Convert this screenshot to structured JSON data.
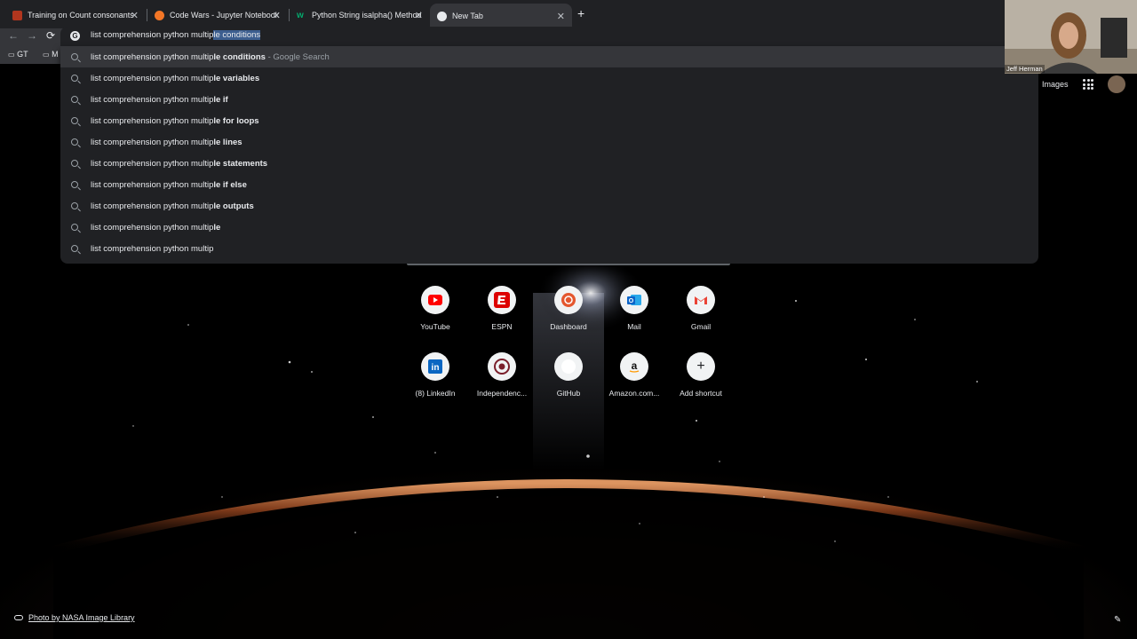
{
  "tabs": [
    {
      "title": "Training on Count consonants",
      "icon": "codewars-icon",
      "color": "#b1361e"
    },
    {
      "title": "Code Wars - Jupyter Notebook",
      "icon": "jupyter-icon",
      "color": "#f37626"
    },
    {
      "title": "Python String isalpha() Method",
      "icon": "w3schools-icon",
      "color": "#04aa6d"
    },
    {
      "title": "New Tab",
      "icon": "chrome-icon",
      "color": "#e8eaed"
    }
  ],
  "omnibox": {
    "typed": "list comprehension python multip",
    "selected": "le conditions"
  },
  "bookmarks": {
    "gt": "GT",
    "folder": "M"
  },
  "suggestions": [
    {
      "prefix": "list comprehension python multip",
      "bold": "le conditions",
      "suffix": " - Google Search"
    },
    {
      "prefix": "list comprehension python multip",
      "bold": "le variables",
      "suffix": ""
    },
    {
      "prefix": "list comprehension python multip",
      "bold": "le if",
      "suffix": ""
    },
    {
      "prefix": "list comprehension python multip",
      "bold": "le for loops",
      "suffix": ""
    },
    {
      "prefix": "list comprehension python multip",
      "bold": "le lines",
      "suffix": ""
    },
    {
      "prefix": "list comprehension python multip",
      "bold": "le statements",
      "suffix": ""
    },
    {
      "prefix": "list comprehension python multip",
      "bold": "le if else",
      "suffix": ""
    },
    {
      "prefix": "list comprehension python multip",
      "bold": "le outputs",
      "suffix": ""
    },
    {
      "prefix": "list comprehension python multip",
      "bold": "le",
      "suffix": ""
    },
    {
      "prefix": "list comprehension python multip",
      "bold": "",
      "suffix": ""
    }
  ],
  "header": {
    "images": "Images"
  },
  "webcam": {
    "name": "Jeff Herman"
  },
  "shortcuts": [
    {
      "label": "YouTube",
      "icon": "youtube-icon",
      "color": "#ff0000"
    },
    {
      "label": "ESPN",
      "icon": "espn-icon",
      "color": "#d00"
    },
    {
      "label": "Dashboard",
      "icon": "dashboard-icon",
      "color": "#e4572e"
    },
    {
      "label": "Mail",
      "icon": "outlook-icon",
      "color": "#0a64c8"
    },
    {
      "label": "Gmail",
      "icon": "gmail-icon",
      "color": "#ea4335"
    },
    {
      "label": "(8) LinkedIn",
      "icon": "linkedin-icon",
      "color": "#0a66c2"
    },
    {
      "label": "Independenc...",
      "icon": "independence-icon",
      "color": "#7a1f2b"
    },
    {
      "label": "GitHub",
      "icon": "github-icon",
      "color": "#ffffff"
    },
    {
      "label": "Amazon.com...",
      "icon": "amazon-icon",
      "color": "#111111"
    },
    {
      "label": "Add shortcut",
      "icon": "plus-icon",
      "color": "#202124"
    }
  ],
  "footer": {
    "credit": "Photo by NASA Image Library"
  }
}
